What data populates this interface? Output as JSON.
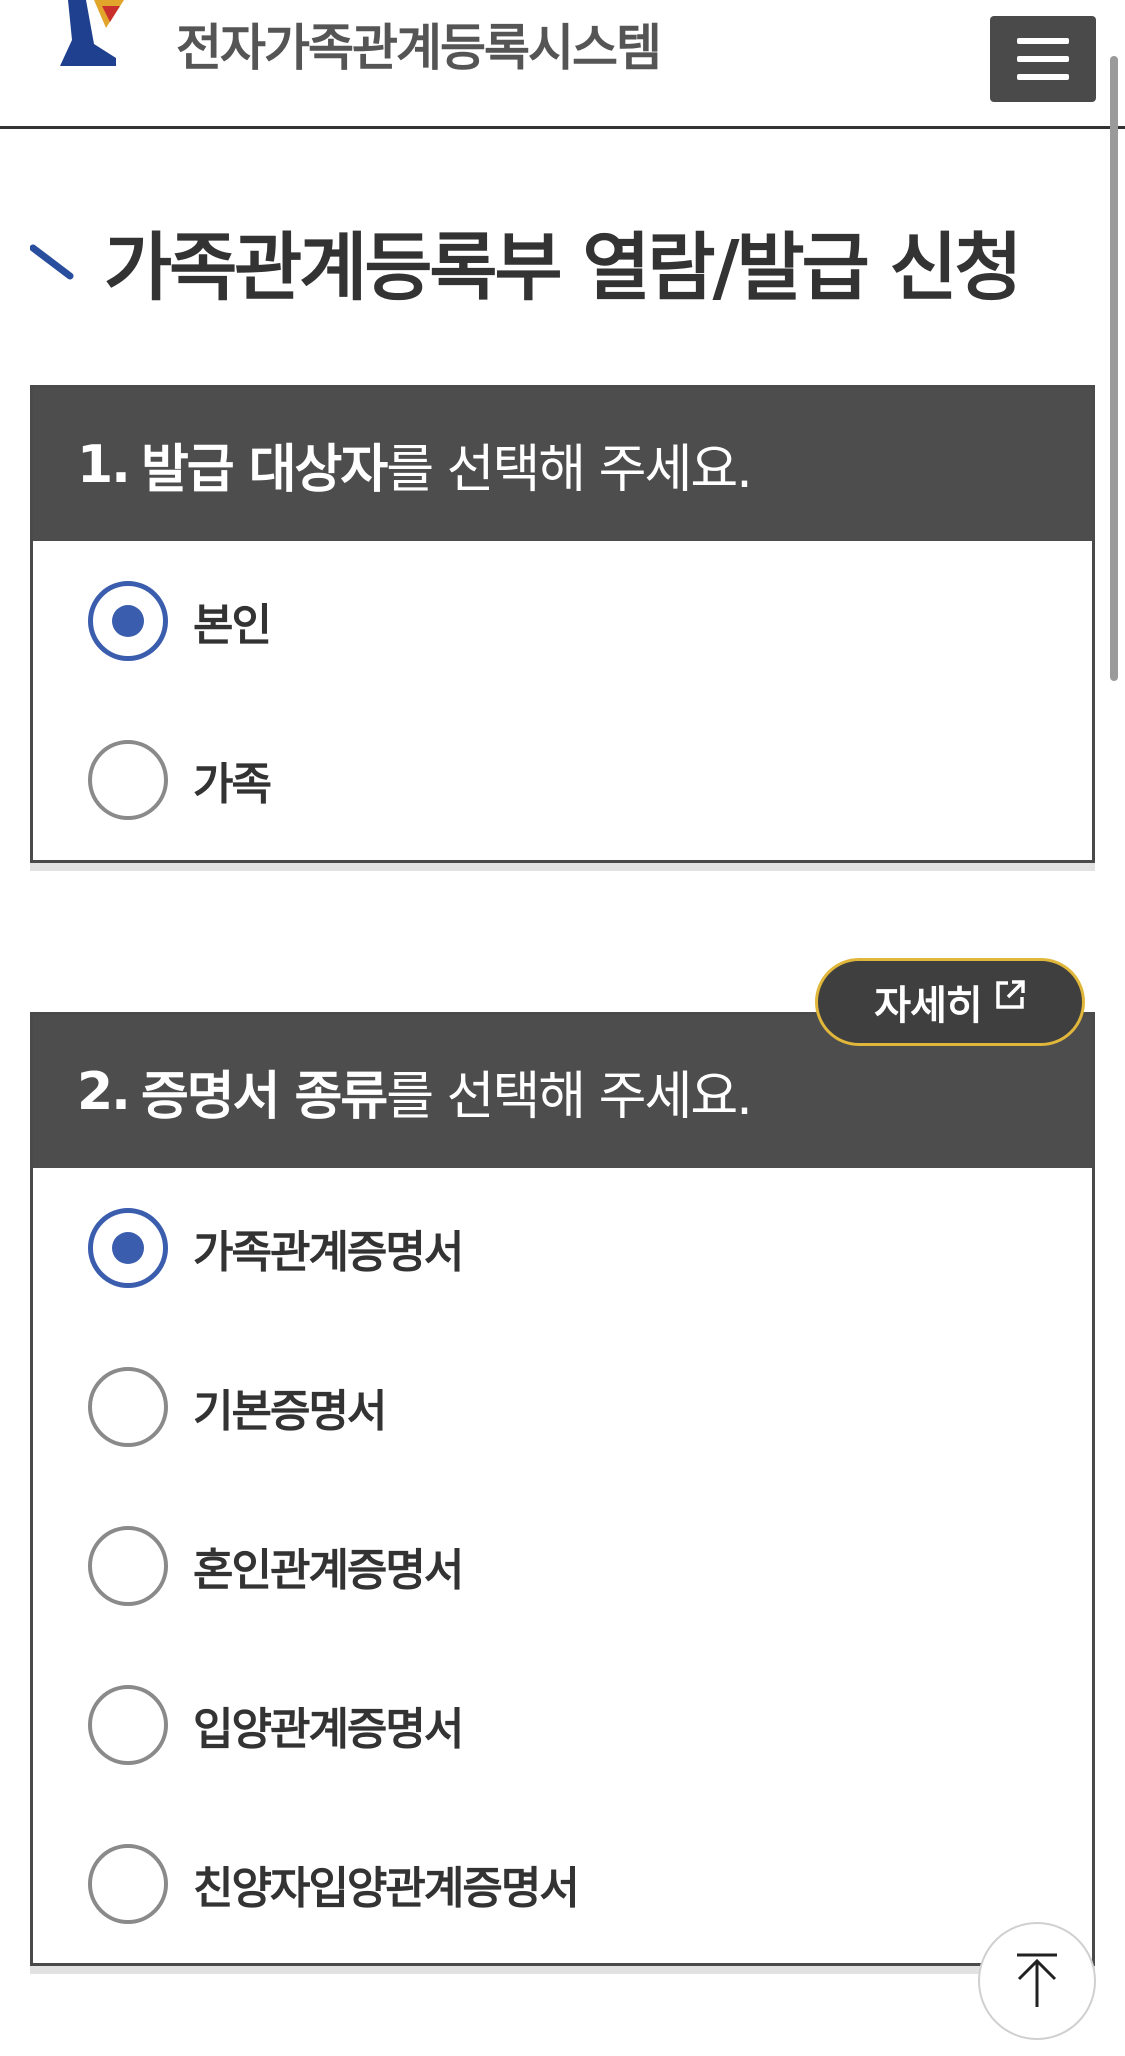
{
  "header": {
    "site_name": "전자가족관계등록시스템",
    "logo_icon": "site-logo-mark",
    "menu_icon": "hamburger-menu-icon"
  },
  "page": {
    "title": "가족관계등록부 열람/발급 신청"
  },
  "section1": {
    "number": "1.",
    "title_strong": "발급 대상자",
    "title_rest": "를 선택해 주세요.",
    "options": [
      {
        "label": "본인",
        "checked": true
      },
      {
        "label": "가족",
        "checked": false
      }
    ]
  },
  "section2": {
    "number": "2.",
    "title_strong": "증명서 종류",
    "title_rest": "를 선택해 주세요.",
    "detail_label": "자세히",
    "detail_icon": "external-link-icon",
    "options": [
      {
        "label": "가족관계증명서",
        "checked": true
      },
      {
        "label": "기본증명서",
        "checked": false
      },
      {
        "label": "혼인관계증명서",
        "checked": false
      },
      {
        "label": "입양관계증명서",
        "checked": false
      },
      {
        "label": "친양자입양관계증명서",
        "checked": false
      }
    ]
  },
  "colors": {
    "header_dark": "#4d4d4d",
    "radio_accent": "#3a5dae",
    "detail_border": "#e0b73a",
    "text": "#333333"
  },
  "floating": {
    "back_to_top_icon": "arrow-up-icon"
  }
}
